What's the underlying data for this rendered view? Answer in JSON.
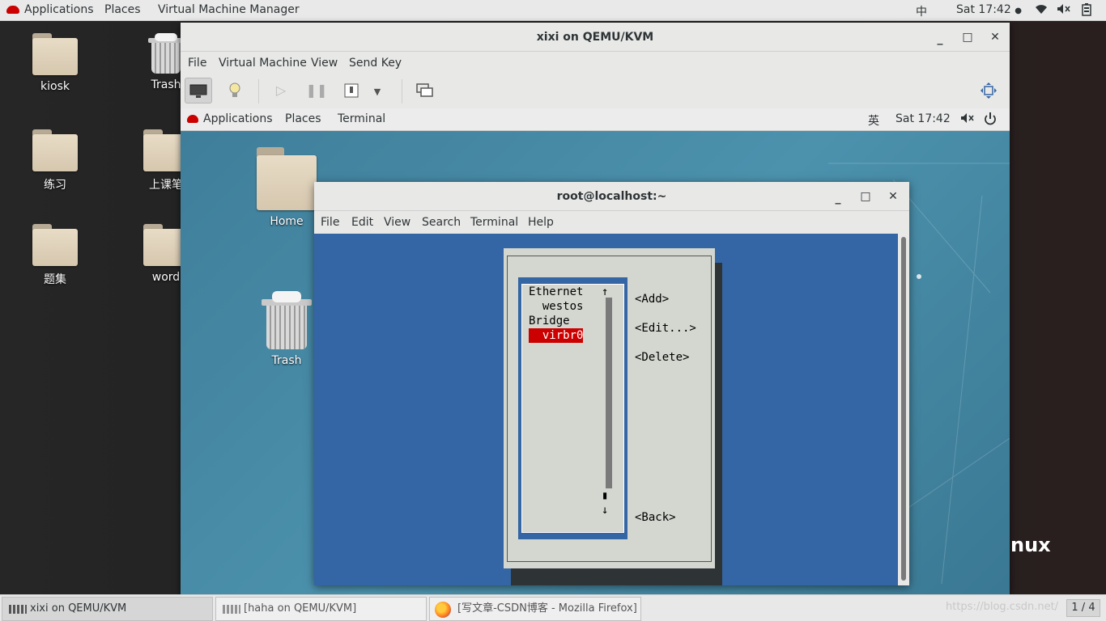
{
  "topbar": {
    "applications": "Applications",
    "places": "Places",
    "app_name": "Virtual Machine Manager",
    "input_method": "中",
    "clock": "Sat 17:42"
  },
  "desktop": {
    "icons": [
      {
        "label": "kiosk"
      },
      {
        "label": "Trash"
      },
      {
        "label": "练习"
      },
      {
        "label": "上课笔"
      },
      {
        "label": "题集"
      },
      {
        "label": "word"
      }
    ]
  },
  "vm_window": {
    "title": "xixi on QEMU/KVM",
    "menu": [
      "File",
      "Virtual Machine",
      "View",
      "Send Key"
    ]
  },
  "guest": {
    "topbar": {
      "applications": "Applications",
      "places": "Places",
      "terminal": "Terminal",
      "input_method": "英",
      "clock": "Sat 17:42"
    },
    "icons": [
      {
        "label": "Home"
      },
      {
        "label": "Trash"
      }
    ],
    "brand_text": "nux",
    "terminal": {
      "title": "root@localhost:~",
      "menu": [
        "File",
        "Edit",
        "View",
        "Search",
        "Terminal",
        "Help"
      ],
      "nmtui": {
        "items": [
          "Ethernet",
          "  westos",
          "Bridge",
          "  virbr0"
        ],
        "selected_index": 3,
        "buttons": [
          "<Add>",
          "<Edit...>",
          "<Delete>",
          "<Back>"
        ],
        "scroll_up": "↑",
        "scroll_down": "↓"
      }
    }
  },
  "taskbar": {
    "tasks": [
      {
        "label": "xixi on QEMU/KVM",
        "active": true
      },
      {
        "label": "[haha on QEMU/KVM]",
        "active": false
      },
      {
        "label": "[写文章-CSDN博客 - Mozilla Firefox]",
        "active": false
      }
    ],
    "watermark": "https://blog.csdn.net/",
    "workspace": "1 / 4"
  },
  "colors": {
    "terminal_bg": "#3465a4",
    "dialog_bg": "#d3d7cf",
    "selection": "#cc0000",
    "guest_desktop": "#4a8aa6"
  }
}
